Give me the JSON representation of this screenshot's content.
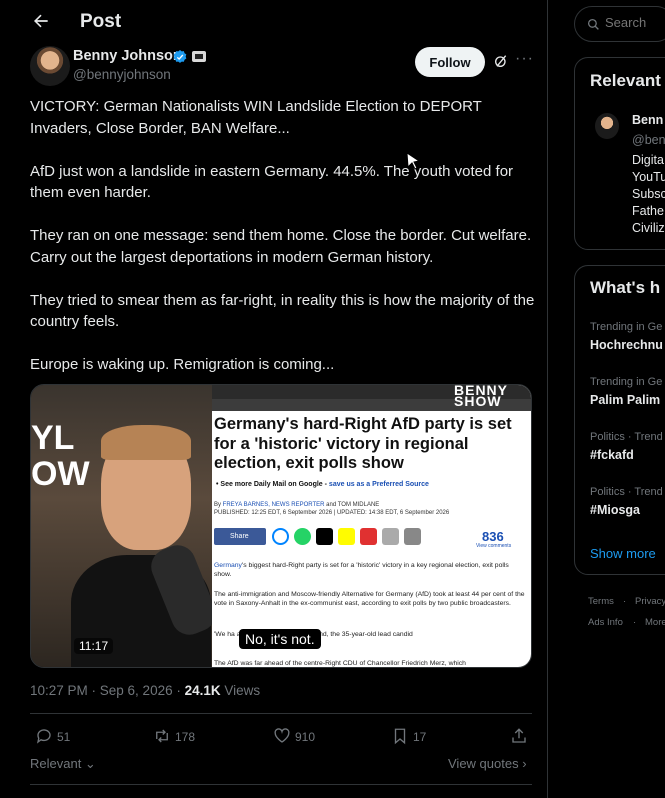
{
  "header": {
    "title": "Post"
  },
  "author": {
    "name": "Benny Johnson",
    "handle": "@bennyjohnson"
  },
  "follow_label": "Follow",
  "more_label": "···",
  "post": {
    "paragraphs": [
      "VICTORY: German Nationalists WIN Landslide Election to DEPORT Invaders, Close Border, BAN Welfare...",
      "AfD just won a landslide in eastern Germany. 44.5%. The youth voted for them even harder.",
      "They ran on one message: send them home. Close the border. Cut welfare. Carry out the largest deportations in modern German history.",
      "They tried to smear them as far-right, in reality this is how the majority of the country feels.",
      "Europe is waking up. Remigration is coming..."
    ]
  },
  "media": {
    "duration": "11:17",
    "caption": "No, it's not.",
    "show_logo": "BENNY SHOW",
    "article": {
      "headline": "Germany's hard-Right AfD party is set for a 'historic' victory in regional election, exit polls show",
      "more_prefix": "• See more Daily Mail on Google - ",
      "more_link": "save us as a Preferred Source",
      "byline_prefix": "By ",
      "byline_author": "FREYA BARNES, NEWS REPORTER",
      "byline_rest": " and TOM MIDLANE",
      "published": "PUBLISHED: 12:25 EDT, 6 September 2026 | UPDATED: 14:38 EDT, 6 September 2026",
      "share_label": "Share",
      "comment_count": "836",
      "comment_sub": "View comments",
      "p1_lead": "Germany",
      "p1": "'s biggest hard-Right party is set for a 'historic' victory in a key regional election, exit polls show.",
      "p2": "The anti-immigration and Moscow-friendly Alternative for Germany (AfD) took at least 44 per cent of the vote in Saxony-Anhalt in the ex-communist east, according to exit polls by two public broadcasters.",
      "p3": "'We ha                              aid a jubilant Ulrich Siegmund, the 35-year-old lead candid",
      "p4": "The AfD was far ahead of the centre-Right CDU of Chancellor Friedrich Merz, which"
    }
  },
  "meta": {
    "time": "10:27 PM · Sep 6, 2026 · ",
    "views_count": "24.1K",
    "views_label": " Views"
  },
  "actions": {
    "replies": "51",
    "reposts": "178",
    "likes": "910",
    "bookmarks": "17"
  },
  "footer": {
    "relevant": "Relevant",
    "view_quotes": "View quotes"
  },
  "sidebar": {
    "search_placeholder": "Search",
    "relevant_title": "Relevant",
    "relevant_name": "Benn",
    "relevant_handle": "@ben",
    "relevant_bio": [
      "Digita",
      "YouTu",
      "Subsc",
      "Fathe",
      "Civiliz"
    ],
    "whats_title": "What's h",
    "trends": [
      {
        "context": "Trending in Ge",
        "name": "Hochrechnu"
      },
      {
        "context": "Trending in Ge",
        "name": "Palim Palim"
      },
      {
        "context": "Politics · Trend",
        "name": "#fckafd"
      },
      {
        "context": "Politics · Trend",
        "name": "#Miosga"
      }
    ],
    "show_more": "Show more",
    "footer_links": [
      "Terms",
      "·",
      "Privacy",
      "Ads Info",
      "·",
      "More"
    ]
  },
  "colors": {
    "accent": "#1d9bf0",
    "background": "#000000",
    "muted": "#71767b",
    "text": "#e7e9ea"
  }
}
